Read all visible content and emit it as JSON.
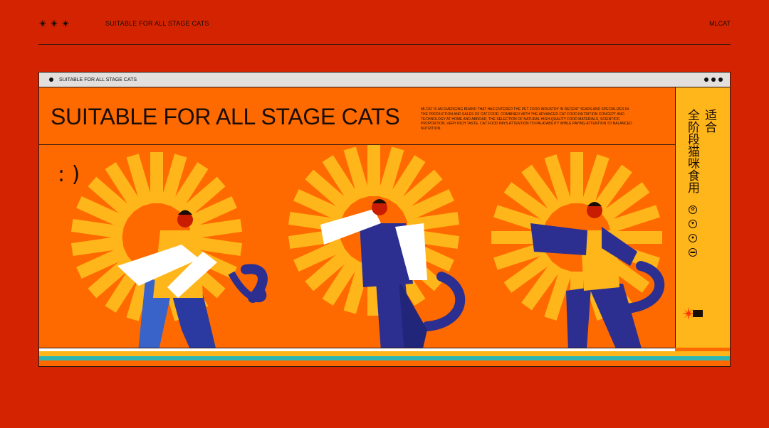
{
  "top_bar": {
    "title": "SUITABLE FOR ALL STAGE CATS",
    "brand": "MLCAT",
    "icons": [
      "flower-icon",
      "flower-icon",
      "flower-icon"
    ]
  },
  "window": {
    "bar_title": "SUITABLE FOR ALL STAGE CATS",
    "headline": "SUITABLE FOR ALL STAGE CATS",
    "description": "MLCAT IS AN EMERGING BRAND THAT HAS ENTERED THE PET FOOD INDUSTRY IN RECENT YEARS AND SPECIALIZES IN THE PRODUCTION AND SALES OF CAT FOOD. COMBINED WITH THE ADVANCED CAT FOOD NUTRITION CONCEPT AND TECHNOLOGY AT HOME AND ABROAD, THE SELECTION OF NATURAL HIGH-QUALITY FOOD MATERIALS, SCIENTIFIC PROPORTION, VERY RICH TASTE. CAT FOOD PAYS ATTENTION TO PALATABILITY WHILE PAYING ATTENTION TO BALANCED NUTRITION.",
    "smiley": ": )"
  },
  "side_panel": {
    "line1": "适合",
    "line2": "全阶段猫咪食用",
    "icons": [
      "leaf-icon",
      "heart-icon",
      "paw-icon",
      "bone-icon"
    ]
  },
  "colors": {
    "background": "#d42300",
    "panel": "#ff6a00",
    "yellow": "#ffb61a",
    "navy": "#2c2f8f",
    "cyan": "#2fb7b3"
  }
}
